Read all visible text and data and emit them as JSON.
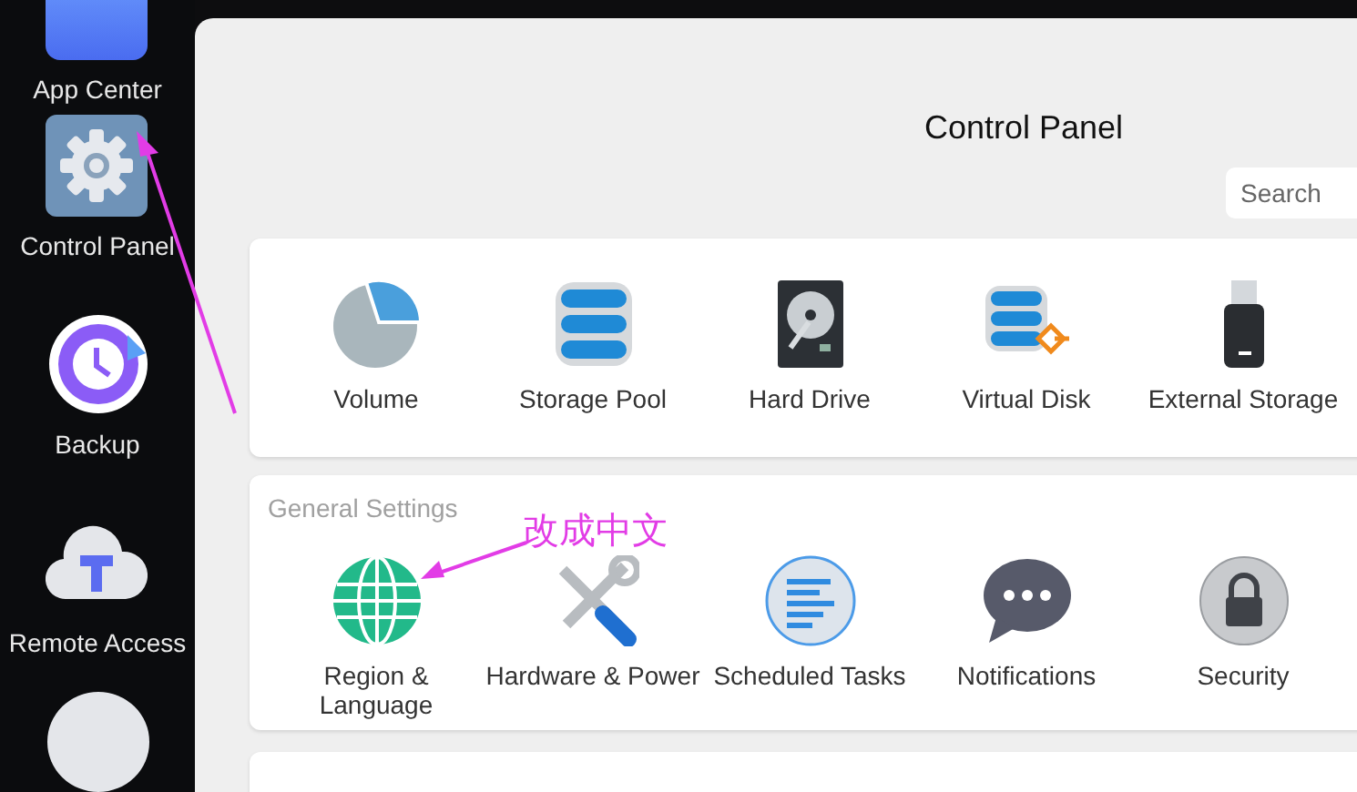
{
  "dock": {
    "items": [
      {
        "label": "App Center"
      },
      {
        "label": "Control Panel"
      },
      {
        "label": "Backup"
      },
      {
        "label": "Remote Access"
      }
    ]
  },
  "window": {
    "title": "Control Panel"
  },
  "search": {
    "placeholder": "Search"
  },
  "storage": {
    "items": [
      {
        "label": "Volume"
      },
      {
        "label": "Storage Pool"
      },
      {
        "label": "Hard Drive"
      },
      {
        "label": "Virtual Disk"
      },
      {
        "label": "External Storage"
      }
    ]
  },
  "general_settings": {
    "heading": "General Settings",
    "items": [
      {
        "label": "Region & Language"
      },
      {
        "label": "Hardware & Power"
      },
      {
        "label": "Scheduled Tasks"
      },
      {
        "label": "Notifications"
      },
      {
        "label": "Security"
      }
    ]
  },
  "annotation": {
    "text": "改成中文"
  }
}
